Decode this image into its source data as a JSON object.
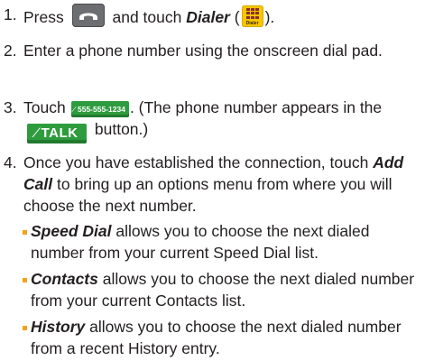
{
  "steps": [
    {
      "num": "1.",
      "text_a": "Press",
      "call_key_icon": "phone-handset-icon",
      "text_b": "and touch",
      "dialer_label": "Dialer",
      "text_c": "(",
      "dialer_icon_label": "Dialer",
      "text_d": ")."
    },
    {
      "num": "2.",
      "text": "Enter a phone number using the onscreen dial pad."
    },
    {
      "num": "3.",
      "text_a": "Touch",
      "number_button": "555-555-1234",
      "text_b": ". (The phone number appears in the",
      "talk_button": "TALK",
      "text_c": "button.)"
    },
    {
      "num": "4.",
      "text_a": "Once you have established the connection, touch",
      "add_call": "Add Call",
      "text_b": "to bring up an options menu from where you will choose the next number."
    }
  ],
  "bullets": [
    {
      "term": "Speed Dial",
      "text": "allows you to choose the next dialed number from your current Speed Dial list."
    },
    {
      "term": "Contacts",
      "text": "allows you to choose the next dialed number from your current Contacts list."
    },
    {
      "term": "History",
      "text": "allows you to choose the next dialed number from a recent History entry."
    }
  ],
  "colors": {
    "bullet": "#f5a21b",
    "talk_green": "#2e9c3e",
    "dialer_yellow": "#f7c600",
    "key_gray": "#6d6e71"
  }
}
